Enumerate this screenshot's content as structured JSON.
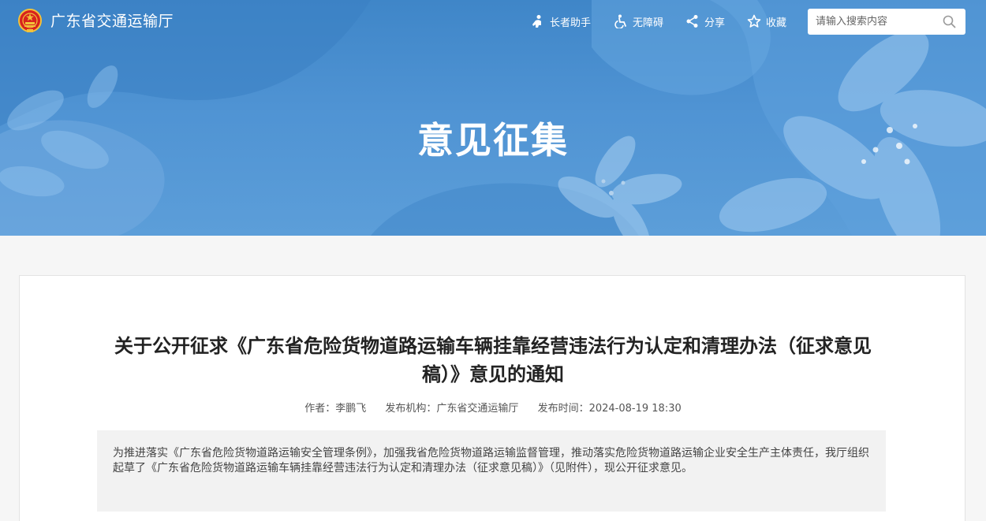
{
  "header": {
    "site_name": "广东省交通运输厅",
    "tools": {
      "elder_label": "长者助手",
      "accessibility_label": "无障碍",
      "share_label": "分享",
      "favorite_label": "收藏"
    },
    "search": {
      "placeholder": "请输入搜索内容",
      "value": ""
    }
  },
  "banner": {
    "title": "意见征集"
  },
  "article": {
    "title": "关于公开征求《广东省危险货物道路运输车辆挂靠经营违法行为认定和清理办法（征求意见稿）》意见的通知",
    "meta": {
      "author_label": "作者：",
      "author": "李鹏飞",
      "publisher_label": "发布机构：",
      "publisher": "广东省交通运输厅",
      "time_label": "发布时间：",
      "time": "2024-08-19 18:30"
    },
    "abstract": "为推进落实《广东省危险货物道路运输安全管理条例》，加强我省危险货物道路运输监督管理，推动落实危险货物道路运输企业安全生产主体责任，我厅组织起草了《广东省危险货物道路运输车辆挂靠经营违法行为认定和清理办法（征求意见稿）》（见附件），现公开征求意见。"
  },
  "colors": {
    "banner_blue": "#4f93d3",
    "emblem_red": "#d8231d",
    "emblem_gold": "#f2c23a",
    "page_bg": "#f6f6f6",
    "abstract_bg": "#f2f2f2"
  },
  "icons": {
    "emblem": "national-emblem-icon",
    "elder": "elder-helper-icon",
    "accessibility": "wheelchair-icon",
    "share": "share-icon",
    "favorite": "star-icon",
    "search": "search-icon"
  }
}
